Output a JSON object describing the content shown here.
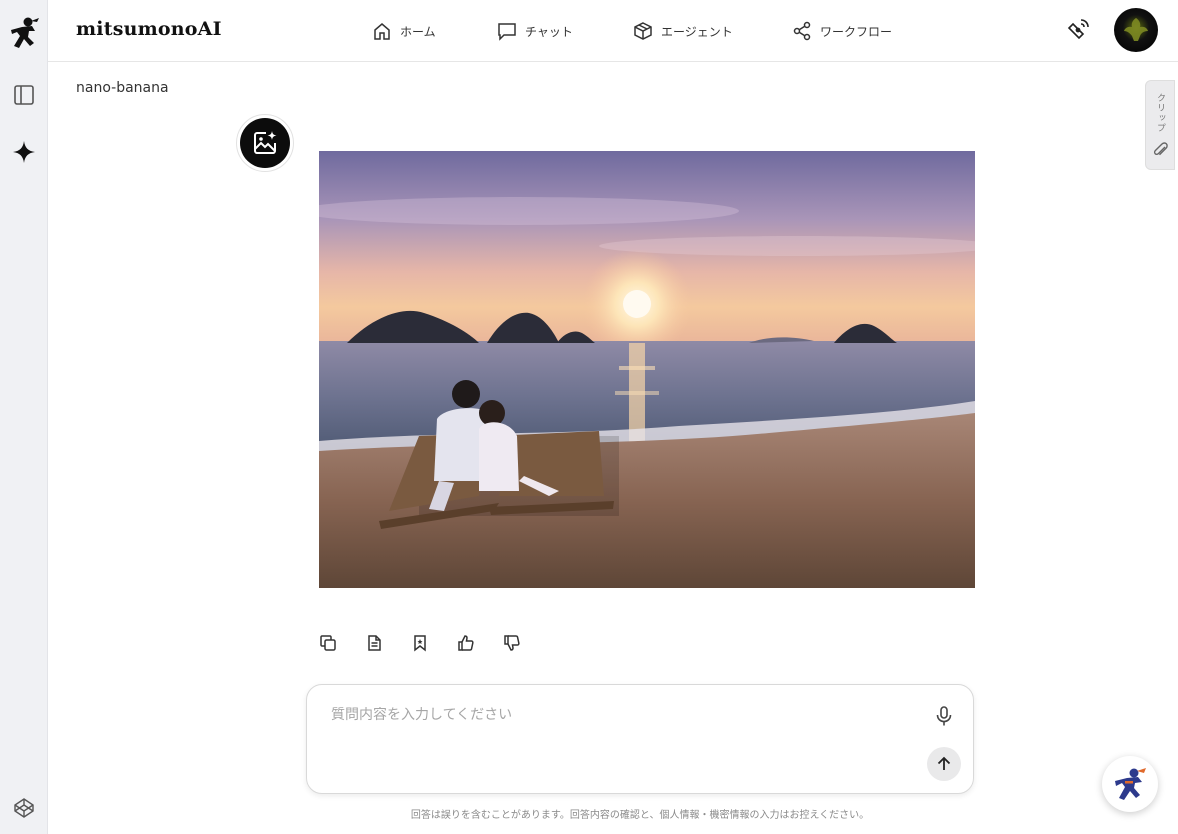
{
  "app": {
    "brand": "mitsumonoAI"
  },
  "nav": [
    {
      "label": "ホーム",
      "icon": "home-icon"
    },
    {
      "label": "チャット",
      "icon": "chat-icon"
    },
    {
      "label": "エージェント",
      "icon": "cube-icon"
    },
    {
      "label": "ワークフロー",
      "icon": "share-icon"
    }
  ],
  "header": {
    "right_icons": [
      "satellite-icon",
      "user-avatar"
    ]
  },
  "sidebar": {
    "icons": [
      "ninja-logo-icon",
      "sidebar-toggle-icon",
      "sparkle-icon",
      "codepen-icon"
    ]
  },
  "chat": {
    "model_name": "nano-banana",
    "actions": [
      "copy-icon",
      "document-icon",
      "bookmark-icon",
      "thumbs-up-icon",
      "thumbs-down-icon"
    ]
  },
  "composer": {
    "placeholder": "質問内容を入力してください",
    "value": ""
  },
  "disclaimer": "回答は誤りを含むことがあります。回答内容の確認と、個人情報・機密情報の入力はお控えください。",
  "clip_tab": {
    "label": "クリップ"
  },
  "colors": {
    "accent": "#000000",
    "rail_bg": "#f0f1f4",
    "mascot_blue": "#2d3a8c"
  }
}
